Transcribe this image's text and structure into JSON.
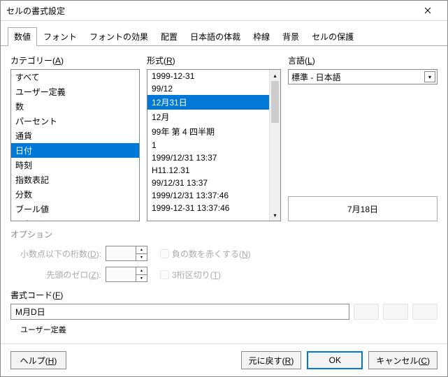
{
  "titlebar": {
    "title": "セルの書式設定"
  },
  "tabs": [
    "数値",
    "フォント",
    "フォントの効果",
    "配置",
    "日本語の体裁",
    "枠線",
    "背景",
    "セルの保護"
  ],
  "active_tab": 0,
  "category": {
    "label_pre": "カテゴリー(",
    "label_u": "A",
    "label_post": ")",
    "items": [
      "すべて",
      "ユーザー定義",
      "数",
      "パーセント",
      "通貨",
      "日付",
      "時刻",
      "指数表記",
      "分数",
      "ブール値",
      "テキスト"
    ],
    "selected": 5
  },
  "format": {
    "label_pre": "形式(",
    "label_u": "R",
    "label_post": ")",
    "items": [
      "1999-12-31",
      "99/12",
      "12月31日",
      "12月",
      "99年 第 4 四半期",
      "1",
      "1999/12/31 13:37",
      "H11.12.31",
      "99/12/31 13:37",
      "1999/12/31 13:37:46",
      "1999-12-31 13:37:46"
    ],
    "selected": 2
  },
  "language": {
    "label_pre": "言語(",
    "label_u": "L",
    "label_post": ")",
    "value": "標準 - 日本語"
  },
  "preview": "7月18日",
  "options": {
    "title": "オプション",
    "decimals_pre": "小数点以下の桁数(",
    "decimals_u": "D",
    "decimals_post": "):",
    "decimals_val": "",
    "zeros_pre": "先頭のゼロ(",
    "zeros_u": "Z",
    "zeros_post": "):",
    "zeros_val": "",
    "negred_pre": "負の数を赤くする(",
    "negred_u": "N",
    "negred_post": ")",
    "thousands_pre": "3桁区切り(",
    "thousands_u": "T",
    "thousands_post": ")"
  },
  "format_code": {
    "label_pre": "書式コード(",
    "label_u": "F",
    "label_post": ")",
    "value": "M月D日",
    "userdef": "ユーザー定義"
  },
  "buttons": {
    "help_pre": "ヘルプ(",
    "help_u": "H",
    "help_post": ")",
    "reset_pre": "元に戻す(",
    "reset_u": "R",
    "reset_post": ")",
    "ok": "OK",
    "cancel_pre": "キャンセル(",
    "cancel_u": "C",
    "cancel_post": ")"
  }
}
